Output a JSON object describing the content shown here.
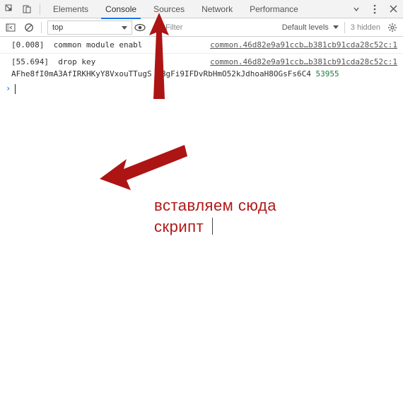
{
  "tabs": {
    "elements": "Elements",
    "console": "Console",
    "sources": "Sources",
    "network": "Network",
    "performance": "Performance"
  },
  "toolbar": {
    "context": "top",
    "filter_placeholder": "Filter",
    "levels_label": "Default levels",
    "hidden_label": "3 hidden"
  },
  "logs": {
    "line1_msg": "[0.008]  common module enabl",
    "line1_src": "common.46d82e9a91ccb…b381cb91cda28c52c:1",
    "line2_msg": "[55.694]  drop key",
    "line2_src": "common.46d82e9a91ccb…b381cb91cda28c52c:1",
    "line3_pre": "AFhe8fI0mA3AfIRKHKyY8VxouTTugS  BgFi9IFDvRbHmO52kJdhoaH8OGsFs6C4 ",
    "line3_code": "53955"
  },
  "prompt": {
    "symbol": "›"
  },
  "annotation": {
    "line1": "вставляем сюда",
    "line2": "скрипт"
  },
  "colors": {
    "accent_red": "#b01919",
    "link_blue": "#1a73e8"
  }
}
